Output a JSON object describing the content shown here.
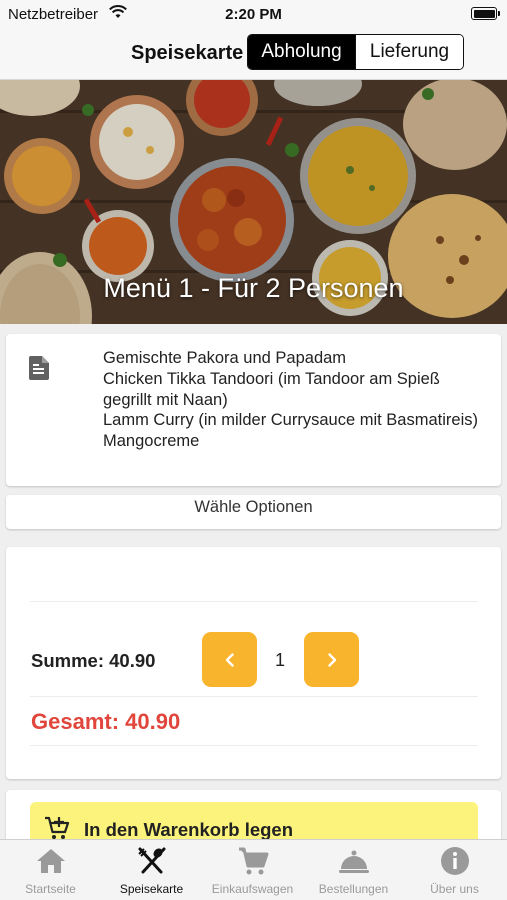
{
  "status_bar": {
    "carrier": "Netzbetreiber",
    "time": "2:20 PM"
  },
  "nav": {
    "title": "Speisekarte",
    "segments": [
      "Abholung",
      "Lieferung"
    ],
    "selected_segment": "Abholung"
  },
  "hero": {
    "title": "Menü 1 - Für 2 Personen"
  },
  "description": {
    "icon": "document-icon",
    "lines": [
      "Gemischte Pakora und Papadam",
      "Chicken Tikka Tandoori (im Tandoor am Spieß gegrillt mit Naan)",
      "Lamm Curry (in milder Currysauce mit Basmatireis)",
      "Mangocreme"
    ]
  },
  "options": {
    "label": "Wähle Optionen"
  },
  "totals": {
    "sum_label": "Summe: 40.90",
    "quantity": "1",
    "total_label": "Gesamt: 40.90"
  },
  "cart": {
    "label": "In den Warenkorb legen",
    "icon": "cart-add-icon"
  },
  "tabs": [
    {
      "label": "Startseite",
      "icon": "home-icon"
    },
    {
      "label": "Speisekarte",
      "icon": "cutlery-icon"
    },
    {
      "label": "Einkaufswagen",
      "icon": "cart-icon"
    },
    {
      "label": "Bestellungen",
      "icon": "cloche-icon"
    },
    {
      "label": "Über uns",
      "icon": "info-icon"
    }
  ],
  "colors": {
    "accent": "#f8b42c",
    "total": "#e0463c",
    "cart_button": "#fbf37b",
    "tab_active": "#111111",
    "tab_inactive": "#9a9a9a"
  }
}
